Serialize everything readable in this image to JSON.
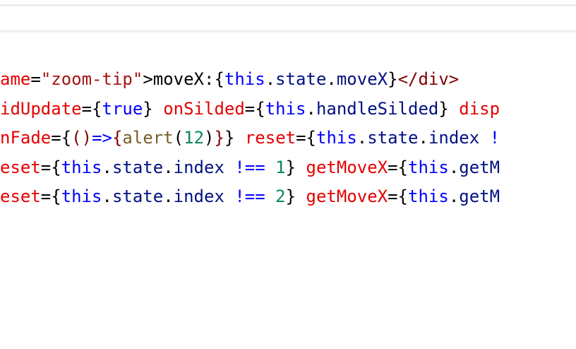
{
  "colors": {
    "attr": "#e50000",
    "string": "#a31515",
    "keyword": "#0000ff",
    "identifier": "#001080",
    "number": "#09885a",
    "function": "#795e26",
    "punct": "#000000",
    "tag": "#800000"
  },
  "code_lines": [
    [
      {
        "text": "ame",
        "kind": "attr"
      },
      {
        "text": "=",
        "kind": "punct"
      },
      {
        "text": "\"zoom-tip\"",
        "kind": "string"
      },
      {
        "text": ">moveX:{",
        "kind": "punct"
      },
      {
        "text": "this",
        "kind": "keyword"
      },
      {
        "text": ".",
        "kind": "punct"
      },
      {
        "text": "state",
        "kind": "identifier"
      },
      {
        "text": ".",
        "kind": "punct"
      },
      {
        "text": "moveX",
        "kind": "identifier"
      },
      {
        "text": "}",
        "kind": "punct"
      },
      {
        "text": "</div>",
        "kind": "tag"
      }
    ],
    [
      {
        "text": "idUpdate",
        "kind": "attr"
      },
      {
        "text": "={",
        "kind": "punct"
      },
      {
        "text": "true",
        "kind": "keyword"
      },
      {
        "text": "} ",
        "kind": "punct"
      },
      {
        "text": "onSilded",
        "kind": "attr"
      },
      {
        "text": "={",
        "kind": "punct"
      },
      {
        "text": "this",
        "kind": "keyword"
      },
      {
        "text": ".",
        "kind": "punct"
      },
      {
        "text": "handleSilded",
        "kind": "identifier"
      },
      {
        "text": "} ",
        "kind": "punct"
      },
      {
        "text": "disp",
        "kind": "attr"
      }
    ],
    [
      {
        "text": "nFade",
        "kind": "attr"
      },
      {
        "text": "={",
        "kind": "punct"
      },
      {
        "text": "()",
        "kind": "tag"
      },
      {
        "text": "=>",
        "kind": "keyword"
      },
      {
        "text": "{",
        "kind": "tag"
      },
      {
        "text": "alert",
        "kind": "function"
      },
      {
        "text": "(",
        "kind": "punct"
      },
      {
        "text": "12",
        "kind": "number"
      },
      {
        "text": ")",
        "kind": "punct"
      },
      {
        "text": "}",
        "kind": "tag"
      },
      {
        "text": "} ",
        "kind": "punct"
      },
      {
        "text": "reset",
        "kind": "attr"
      },
      {
        "text": "={",
        "kind": "punct"
      },
      {
        "text": "this",
        "kind": "keyword"
      },
      {
        "text": ".",
        "kind": "punct"
      },
      {
        "text": "state",
        "kind": "identifier"
      },
      {
        "text": ".",
        "kind": "punct"
      },
      {
        "text": "index",
        "kind": "identifier"
      },
      {
        "text": " !",
        "kind": "keyword"
      }
    ],
    [
      {
        "text": "eset",
        "kind": "attr"
      },
      {
        "text": "={",
        "kind": "punct"
      },
      {
        "text": "this",
        "kind": "keyword"
      },
      {
        "text": ".",
        "kind": "punct"
      },
      {
        "text": "state",
        "kind": "identifier"
      },
      {
        "text": ".",
        "kind": "punct"
      },
      {
        "text": "index",
        "kind": "identifier"
      },
      {
        "text": " !== ",
        "kind": "keyword"
      },
      {
        "text": "1",
        "kind": "number"
      },
      {
        "text": "} ",
        "kind": "punct"
      },
      {
        "text": "getMoveX",
        "kind": "attr"
      },
      {
        "text": "={",
        "kind": "punct"
      },
      {
        "text": "this",
        "kind": "keyword"
      },
      {
        "text": ".",
        "kind": "punct"
      },
      {
        "text": "getM",
        "kind": "identifier"
      }
    ],
    [
      {
        "text": "eset",
        "kind": "attr"
      },
      {
        "text": "={",
        "kind": "punct"
      },
      {
        "text": "this",
        "kind": "keyword"
      },
      {
        "text": ".",
        "kind": "punct"
      },
      {
        "text": "state",
        "kind": "identifier"
      },
      {
        "text": ".",
        "kind": "punct"
      },
      {
        "text": "index",
        "kind": "identifier"
      },
      {
        "text": " !== ",
        "kind": "keyword"
      },
      {
        "text": "2",
        "kind": "number"
      },
      {
        "text": "} ",
        "kind": "punct"
      },
      {
        "text": "getMoveX",
        "kind": "attr"
      },
      {
        "text": "={",
        "kind": "punct"
      },
      {
        "text": "this",
        "kind": "keyword"
      },
      {
        "text": ".",
        "kind": "punct"
      },
      {
        "text": "getM",
        "kind": "identifier"
      }
    ]
  ]
}
